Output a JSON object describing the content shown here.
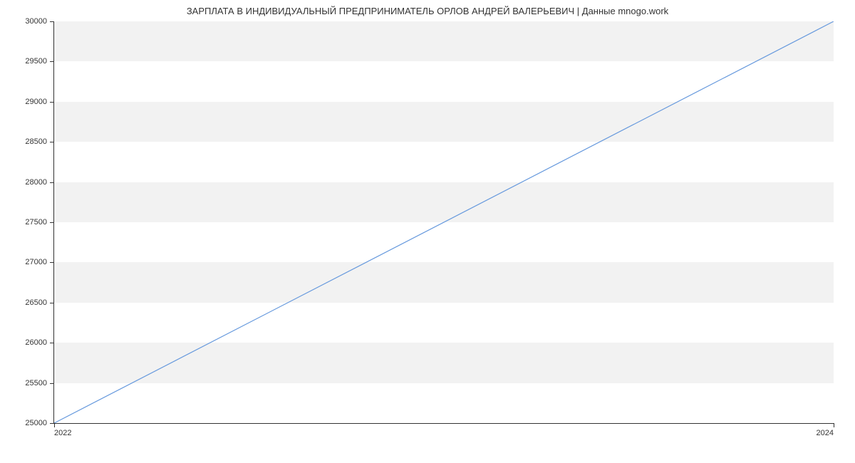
{
  "chart_data": {
    "type": "line",
    "title": "ЗАРПЛАТА В ИНДИВИДУАЛЬНЫЙ ПРЕДПРИНИМАТЕЛЬ ОРЛОВ АНДРЕЙ ВАЛЕРЬЕВИЧ | Данные mnogo.work",
    "x": [
      2022,
      2024
    ],
    "values": [
      25000,
      30000
    ],
    "xlabel": "",
    "ylabel": "",
    "xlim": [
      2022,
      2024
    ],
    "ylim": [
      25000,
      30000
    ],
    "y_ticks": [
      25000,
      25500,
      26000,
      26500,
      27000,
      27500,
      28000,
      28500,
      29000,
      29500,
      30000
    ],
    "x_ticks": [
      2022,
      2024
    ],
    "line_color": "#6699dd"
  }
}
